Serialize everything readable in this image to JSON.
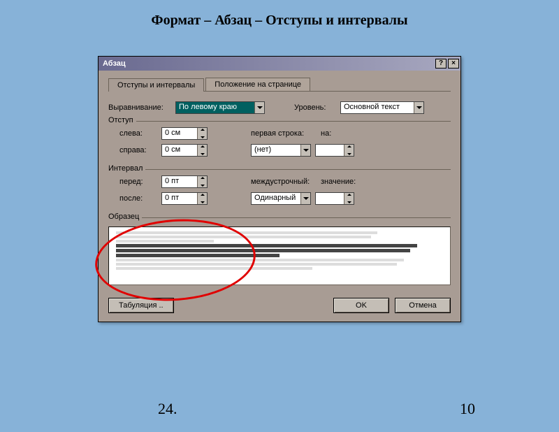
{
  "slide": {
    "title": "Формат – Абзац – Отступы и интервалы",
    "footer_left": "24.",
    "footer_right": "10"
  },
  "dialog": {
    "title": "Абзац",
    "help": "?",
    "close": "×",
    "tabs": {
      "tab1": "Отступы и интервалы",
      "tab2": "Положение на странице"
    },
    "alignment": {
      "label": "Выравнивание:",
      "value": "По левому краю"
    },
    "level": {
      "label": "Уровень:",
      "value": "Основной текст"
    },
    "indent": {
      "legend": "Отступ",
      "left_label": "слева:",
      "left_value": "0 см",
      "right_label": "справа:",
      "right_value": "0 см",
      "firstline_label": "первая строка:",
      "firstline_value": "(нет)",
      "by_label": "на:",
      "by_value": ""
    },
    "spacing": {
      "legend": "Интервал",
      "before_label": "перед:",
      "before_value": "0 пт",
      "after_label": "после:",
      "after_value": "0 пт",
      "line_label": "междустрочный:",
      "line_value": "Одинарный",
      "at_label": "значение:",
      "at_value": ""
    },
    "preview": {
      "legend": "Образец"
    },
    "buttons": {
      "tabs": "Табуляция ..",
      "ok": "OK",
      "cancel": "Отмена"
    }
  }
}
